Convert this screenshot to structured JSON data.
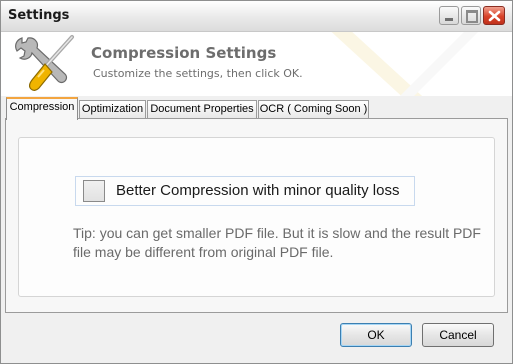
{
  "window": {
    "title": "Settings"
  },
  "header": {
    "title": "Compression Settings",
    "subtitle": "Customize the settings, then click OK.",
    "icon": "tools-icon"
  },
  "tabs": [
    {
      "label": "Compression",
      "active": true
    },
    {
      "label": "Optimization",
      "active": false
    },
    {
      "label": "Document Properties",
      "active": false
    },
    {
      "label": "OCR ( Coming Soon )",
      "active": false
    }
  ],
  "compression": {
    "checkbox_label": "Better Compression with minor quality loss",
    "checked": false,
    "tip": "Tip: you can get smaller PDF file. But it is slow and the result PDF file may be different from original PDF file."
  },
  "buttons": {
    "ok": "OK",
    "cancel": "Cancel"
  }
}
